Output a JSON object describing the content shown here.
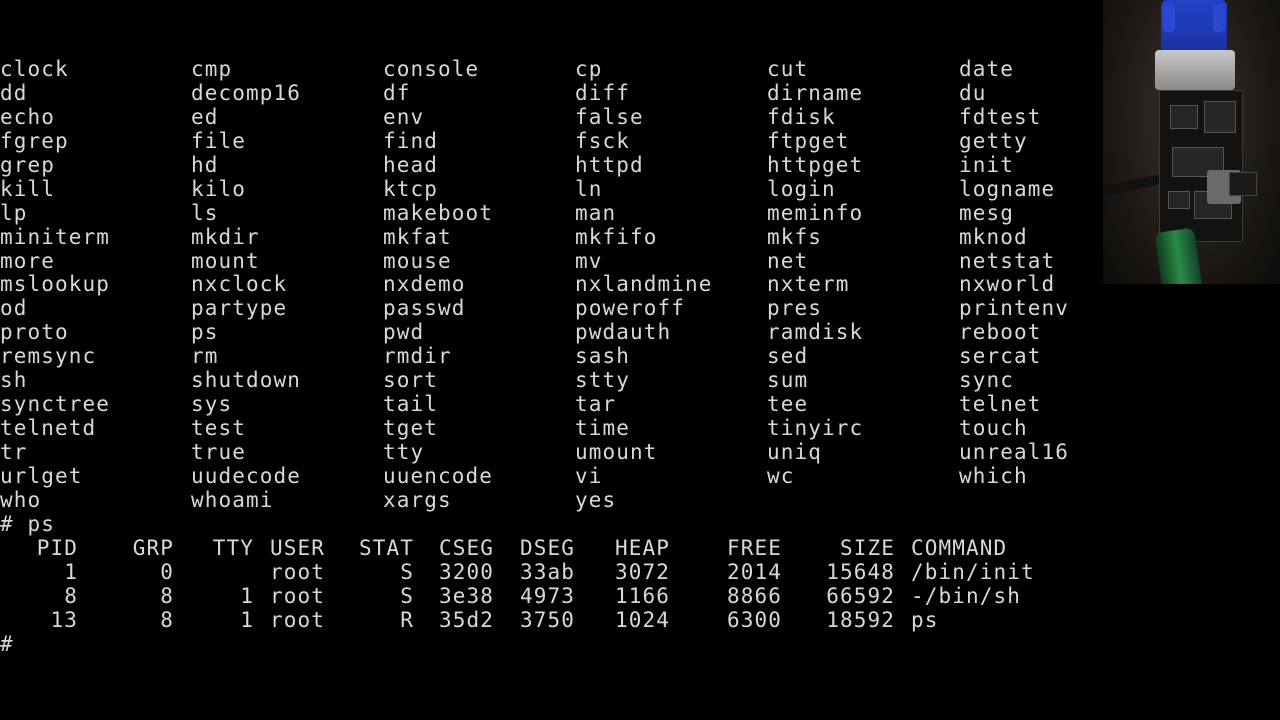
{
  "commands": [
    [
      "clock",
      "cmp",
      "console",
      "cp",
      "cut",
      "date"
    ],
    [
      "dd",
      "decomp16",
      "df",
      "diff",
      "dirname",
      "du"
    ],
    [
      "echo",
      "ed",
      "env",
      "false",
      "fdisk",
      "fdtest"
    ],
    [
      "fgrep",
      "file",
      "find",
      "fsck",
      "ftpget",
      "getty"
    ],
    [
      "grep",
      "hd",
      "head",
      "httpd",
      "httpget",
      "init"
    ],
    [
      "kill",
      "kilo",
      "ktcp",
      "ln",
      "login",
      "logname"
    ],
    [
      "lp",
      "ls",
      "makeboot",
      "man",
      "meminfo",
      "mesg"
    ],
    [
      "miniterm",
      "mkdir",
      "mkfat",
      "mkfifo",
      "mkfs",
      "mknod"
    ],
    [
      "more",
      "mount",
      "mouse",
      "mv",
      "net",
      "netstat"
    ],
    [
      "mslookup",
      "nxclock",
      "nxdemo",
      "nxlandmine",
      "nxterm",
      "nxworld"
    ],
    [
      "od",
      "partype",
      "passwd",
      "poweroff",
      "pres",
      "printenv"
    ],
    [
      "proto",
      "ps",
      "pwd",
      "pwdauth",
      "ramdisk",
      "reboot"
    ],
    [
      "remsync",
      "rm",
      "rmdir",
      "sash",
      "sed",
      "sercat"
    ],
    [
      "sh",
      "shutdown",
      "sort",
      "stty",
      "sum",
      "sync"
    ],
    [
      "synctree",
      "sys",
      "tail",
      "tar",
      "tee",
      "telnet"
    ],
    [
      "telnetd",
      "test",
      "tget",
      "time",
      "tinyirc",
      "touch"
    ],
    [
      "tr",
      "true",
      "tty",
      "umount",
      "uniq",
      "unreal16"
    ],
    [
      "urlget",
      "uudecode",
      "uuencode",
      "vi",
      "wc",
      "which"
    ],
    [
      "who",
      "whoami",
      "xargs",
      "yes"
    ]
  ],
  "prompt_line": "# ps",
  "ps": {
    "headers": [
      "PID",
      "GRP",
      "TTY",
      "USER",
      "STAT",
      "CSEG",
      "DSEG",
      "HEAP",
      "FREE",
      "SIZE",
      "COMMAND"
    ],
    "rows": [
      [
        "1",
        "0",
        "",
        "root",
        "S",
        "3200",
        "33ab",
        "3072",
        "2014",
        "15648",
        "/bin/init"
      ],
      [
        "8",
        "8",
        "1",
        "root",
        "S",
        "3e38",
        "4973",
        "1166",
        "8866",
        "66592",
        "-/bin/sh"
      ],
      [
        "13",
        "8",
        "1",
        "root",
        "R",
        "35d2",
        "3750",
        "1024",
        "6300",
        "18592",
        "ps"
      ]
    ]
  },
  "cursor_prompt": "#",
  "camera": {
    "description_icon": "vga-board-photo-icon"
  }
}
